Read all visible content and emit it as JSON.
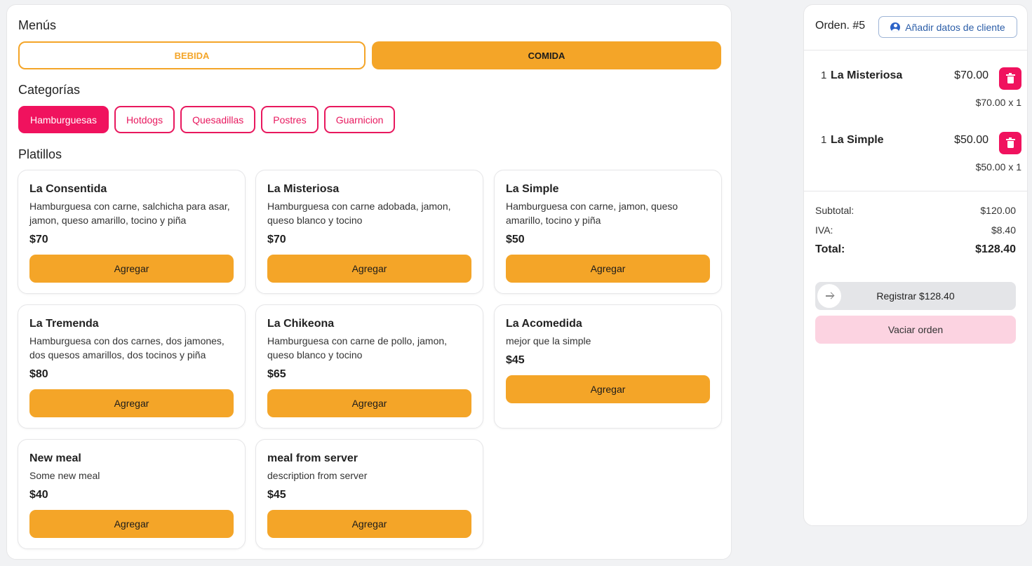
{
  "menus": {
    "title": "Menús",
    "tabs": [
      "BEBIDA",
      "COMIDA"
    ],
    "active_tab": "COMIDA"
  },
  "categories": {
    "title": "Categorías",
    "items": [
      "Hamburguesas",
      "Hotdogs",
      "Quesadillas",
      "Postres",
      "Guarnicion"
    ],
    "active": "Hamburguesas"
  },
  "dishes": {
    "title": "Platillos",
    "add_label": "Agregar",
    "items": [
      {
        "name": "La Consentida",
        "description": "Hamburguesa con carne, salchicha para asar, jamon, queso amarillo, tocino y piña",
        "price": "$70"
      },
      {
        "name": "La Misteriosa",
        "description": "Hamburguesa con carne adobada, jamon, queso blanco y tocino",
        "price": "$70"
      },
      {
        "name": "La Simple",
        "description": "Hamburguesa con carne, jamon, queso amarillo, tocino y piña",
        "price": "$50"
      },
      {
        "name": "La Tremenda",
        "description": "Hamburguesa con dos carnes, dos jamones, dos quesos amarillos, dos tocinos y piña",
        "price": "$80"
      },
      {
        "name": "La Chikeona",
        "description": "Hamburguesa con carne de pollo, jamon, queso blanco y tocino",
        "price": "$65"
      },
      {
        "name": "La Acomedida",
        "description": "mejor que la simple",
        "price": "$45"
      },
      {
        "name": "New meal",
        "description": "Some new meal",
        "price": "$40"
      },
      {
        "name": "meal from server",
        "description": "description from server",
        "price": "$45"
      }
    ]
  },
  "order": {
    "title": "Orden. #5",
    "client_button": "Añadir datos de cliente",
    "items": [
      {
        "qty": "1",
        "name": "La Misteriosa",
        "price": "$70.00",
        "subline": "$70.00 x 1"
      },
      {
        "qty": "1",
        "name": "La Simple",
        "price": "$50.00",
        "subline": "$50.00 x 1"
      }
    ],
    "subtotal_label": "Subtotal:",
    "subtotal": "$120.00",
    "tax_label": "IVA:",
    "tax": "$8.40",
    "total_label": "Total:",
    "total": "$128.40",
    "register_label": "Registrar $128.40",
    "clear_label": "Vaciar orden"
  },
  "colors": {
    "accent_orange": "#f4a528",
    "accent_pink": "#f0125e",
    "clear_pink": "#fcd3e1"
  }
}
